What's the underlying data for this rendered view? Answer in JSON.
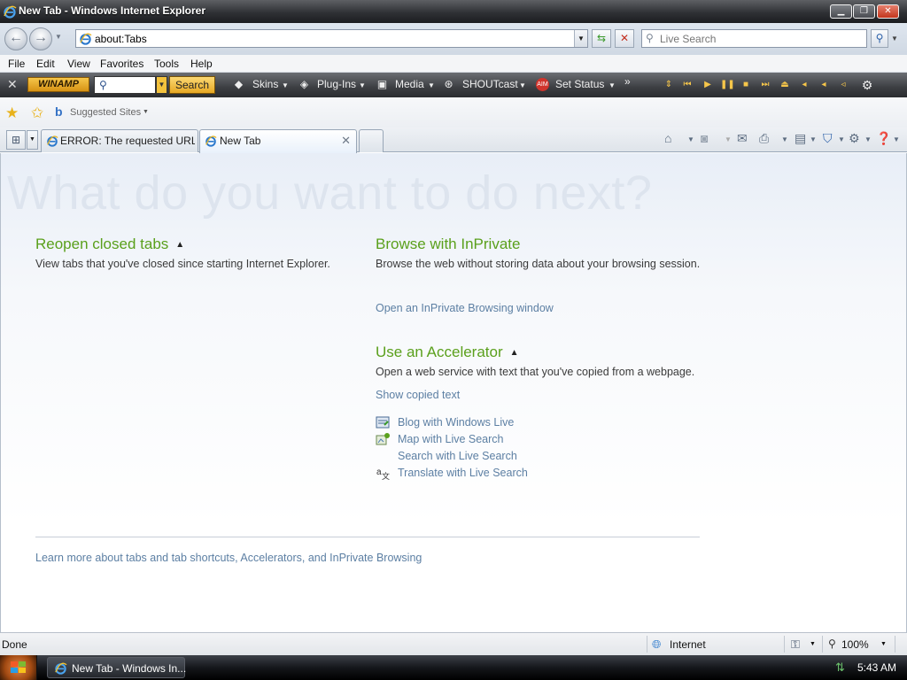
{
  "window": {
    "title": "New Tab - Windows Internet Explorer",
    "min_label": "▁",
    "max_label": "❐",
    "close_label": "✕"
  },
  "address": {
    "url": "about:Tabs",
    "search_placeholder": "Live Search"
  },
  "menu": {
    "file": "File",
    "edit": "Edit",
    "view": "View",
    "favorites": "Favorites",
    "tools": "Tools",
    "help": "Help"
  },
  "winamp": {
    "logo": "WINAMP",
    "search_button": "Search",
    "skins": "Skins",
    "plugins": "Plug-Ins",
    "media": "Media",
    "shoutcast": "SHOUTcast",
    "set_status": "Set Status"
  },
  "favorites_bar": {
    "suggested_sites": "Suggested Sites"
  },
  "tabs": [
    {
      "label": "ERROR: The requested URL ...",
      "active": false
    },
    {
      "label": "New Tab",
      "active": true
    }
  ],
  "page": {
    "headline": "What do you want to do next?",
    "reopen": {
      "title": "Reopen closed tabs",
      "desc": "View tabs that you've closed since starting Internet Explorer."
    },
    "inprivate": {
      "title": "Browse with InPrivate",
      "desc": "Browse the web without storing data about your browsing session.",
      "link": "Open an InPrivate Browsing window"
    },
    "accelerator": {
      "title": "Use an Accelerator",
      "desc": "Open a web service with text that you've copied from a webpage.",
      "show_copied": "Show copied text",
      "items": [
        {
          "label": "Blog with Windows Live",
          "icon": "blog-icon"
        },
        {
          "label": "Map with Live Search",
          "icon": "map-icon"
        },
        {
          "label": "Search with Live Search",
          "icon": "none"
        },
        {
          "label": "Translate with Live Search",
          "icon": "translate-icon"
        }
      ]
    },
    "learn_more": "Learn more about tabs and tab shortcuts, Accelerators, and InPrivate Browsing"
  },
  "status": {
    "text": "Done",
    "zone": "Internet",
    "zoom": "100%"
  },
  "taskbar": {
    "item": "New Tab - Windows In...",
    "clock": "5:43 AM"
  },
  "colors": {
    "accent_green": "#5aa01c",
    "link_blue": "#5c7fa3",
    "winamp_gold": "#f6c64a"
  }
}
